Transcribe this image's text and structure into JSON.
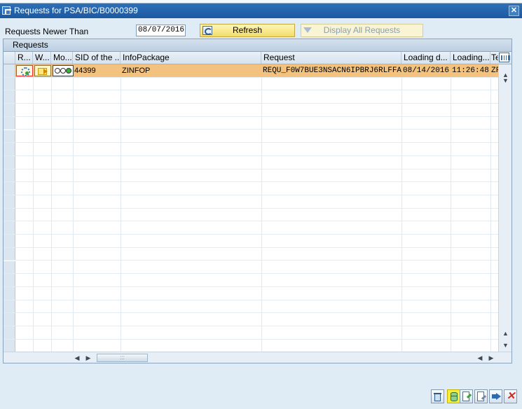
{
  "window": {
    "title": "Requests for PSA/BIC/B0000399",
    "close_glyph": "✕"
  },
  "filter": {
    "label": "Requests Newer Than",
    "date_value": "08/07/2016"
  },
  "buttons": {
    "refresh": "Refresh",
    "display_all": "Display All Requests"
  },
  "grid": {
    "title": "Requests",
    "columns": [
      "R...",
      "W...",
      "Mo...",
      "SID of the ...",
      "InfoPackage",
      "Request",
      "Loading d...",
      "Loading...",
      "Te"
    ],
    "rows": [
      {
        "sid": "44399",
        "infopackage": "ZINFOP",
        "request": "REQU_F0W7BUE3NSACN6IPBRJ6RLFFA",
        "loading_date": "08/14/2016",
        "loading_time": "11:26:48",
        "te": "ZF"
      }
    ],
    "empty_row_count": 21
  },
  "scroll": {
    "up": "▲",
    "down": "▼",
    "left": "◀",
    "right": "▶",
    "thumb_grip": ":::"
  },
  "colors": {
    "selected_row": "#f2c27e",
    "highlight_button": "#f4ee3a",
    "titlebar": "#1f5fa8"
  },
  "icons": {
    "status": "request-status-icon",
    "workflow": "workflow-icon",
    "monitor": "monitor-status-icon"
  }
}
